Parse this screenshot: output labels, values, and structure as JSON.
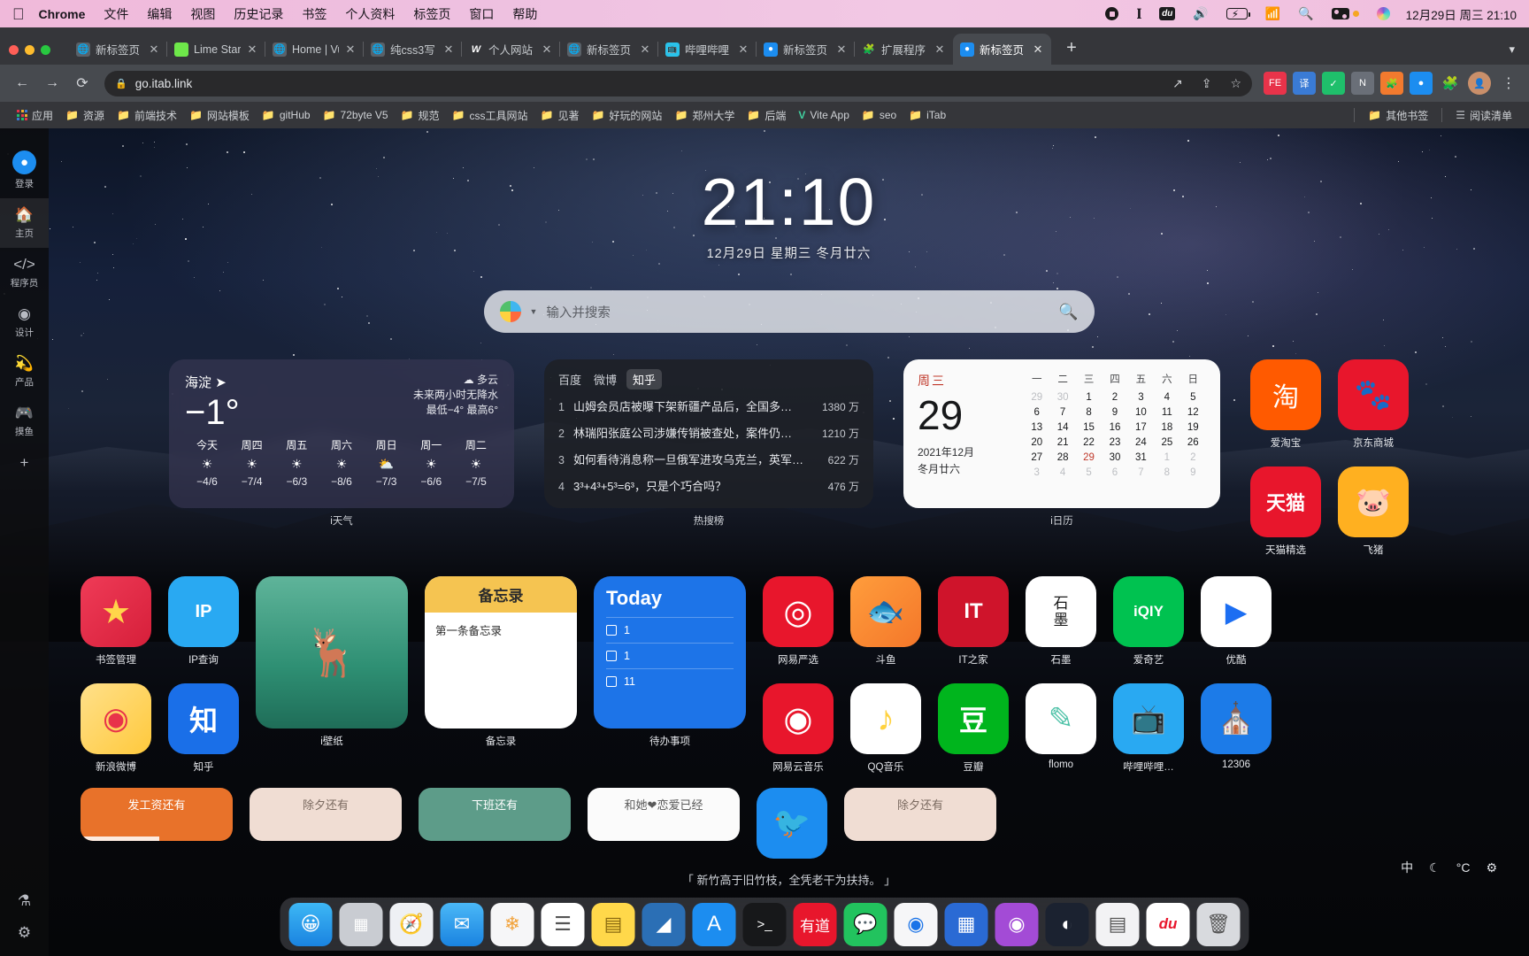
{
  "menubar": {
    "apple_icon": "apple-icon",
    "items": [
      "Chrome",
      "文件",
      "编辑",
      "视图",
      "历史记录",
      "书签",
      "个人资料",
      "标签页",
      "窗口",
      "帮助"
    ],
    "status_icons": [
      "record-icon",
      "p-icon",
      "du-icon",
      "volume-icon",
      "battery-charging-icon",
      "wifi-icon",
      "search-icon",
      "control-center-icon",
      "orange-dot-icon",
      "siri-icon"
    ],
    "clock": "12月29日 周三  21:10"
  },
  "browser": {
    "tabs": [
      {
        "title": "新标签页",
        "favicon": "globe-icon",
        "active": false
      },
      {
        "title": "Lime Star",
        "favicon": "lime-icon",
        "active": false
      },
      {
        "title": "Home | Vu",
        "favicon": "globe-icon",
        "active": false
      },
      {
        "title": "纯css3写",
        "favicon": "globe-icon",
        "active": false
      },
      {
        "title": "个人网站",
        "favicon": "vv-icon",
        "active": false
      },
      {
        "title": "新标签页",
        "favicon": "globe-icon",
        "active": false
      },
      {
        "title": "哔哩哔哩",
        "favicon": "bilibili-icon",
        "active": false
      },
      {
        "title": "新标签页",
        "favicon": "itab-icon",
        "active": false
      },
      {
        "title": "扩展程序",
        "favicon": "puzzle-icon",
        "active": false
      },
      {
        "title": "新标签页",
        "favicon": "itab-icon",
        "active": true
      }
    ],
    "close_label": "✕",
    "new_tab_label": "+",
    "tab_list_chevron": "chevron-down-icon",
    "nav": {
      "back": "←",
      "forward": "→",
      "reload": "⟳"
    },
    "omnibox": {
      "lock": "🔒",
      "url": "go.itab.link",
      "share": "share-icon",
      "install": "install-icon",
      "star": "star-icon"
    },
    "toolbar_icons": [
      "fe-extension-icon",
      "translate-extension-icon",
      "checkmark-extension-icon",
      "n-extension-icon",
      "puzzle-color-icon",
      "itab-extension-icon",
      "extensions-icon",
      "profile-avatar-icon",
      "more-menu-icon"
    ],
    "bookmarks": [
      {
        "icon": "apps-grid-icon",
        "label": "应用"
      },
      {
        "icon": "folder-icon",
        "label": "资源"
      },
      {
        "icon": "folder-icon",
        "label": "前端技术"
      },
      {
        "icon": "folder-icon",
        "label": "网站模板"
      },
      {
        "icon": "folder-icon",
        "label": "gitHub"
      },
      {
        "icon": "folder-icon",
        "label": "72byte V5"
      },
      {
        "icon": "folder-icon",
        "label": "规范"
      },
      {
        "icon": "folder-icon",
        "label": "css工具网站"
      },
      {
        "icon": "folder-icon",
        "label": "见著"
      },
      {
        "icon": "folder-icon",
        "label": "好玩的网站"
      },
      {
        "icon": "folder-icon",
        "label": "郑州大学"
      },
      {
        "icon": "folder-icon",
        "label": "后端"
      },
      {
        "icon": "vite-icon",
        "label": "Vite App"
      },
      {
        "icon": "folder-icon",
        "label": "seo"
      },
      {
        "icon": "folder-icon",
        "label": "iTab"
      }
    ],
    "bookmarks_right": [
      {
        "icon": "folder-icon",
        "label": "其他书签"
      },
      {
        "icon": "reading-list-icon",
        "label": "阅读清单"
      }
    ]
  },
  "rail": {
    "login": {
      "icon": "itab-avatar-icon",
      "label": "登录"
    },
    "items": [
      {
        "icon": "home-icon",
        "label": "主页",
        "selected": true
      },
      {
        "icon": "code-icon",
        "label": "程序员",
        "selected": false
      },
      {
        "icon": "design-icon",
        "label": "设计",
        "selected": false
      },
      {
        "icon": "product-icon",
        "label": "产品",
        "selected": false
      },
      {
        "icon": "game-icon",
        "label": "摸鱼",
        "selected": false
      }
    ],
    "add_label": "+",
    "bottom": [
      {
        "icon": "lab-icon",
        "label": "实验室"
      },
      {
        "icon": "gear-icon",
        "label": "设置"
      }
    ]
  },
  "home": {
    "clock": "21:10",
    "date": "12月29日 星期三 冬月廿六",
    "search": {
      "engine": "search-engine-icon",
      "placeholder": "输入并搜索",
      "submit": "search-icon"
    }
  },
  "weather": {
    "widget_label": "i天气",
    "city": "海淀",
    "location_icon": "location-arrow-icon",
    "temp": "−1°",
    "condition_icon": "cloudy-icon",
    "condition": "多云",
    "forecast_line": "未来两小时无降水",
    "range_line": "最低−4° 最高6°",
    "days": [
      {
        "name": "今天",
        "icon": "sun-icon",
        "range": "−4/6"
      },
      {
        "name": "周四",
        "icon": "sun-icon",
        "range": "−7/4"
      },
      {
        "name": "周五",
        "icon": "sun-icon",
        "range": "−6/3"
      },
      {
        "name": "周六",
        "icon": "sun-icon",
        "range": "−8/6"
      },
      {
        "name": "周日",
        "icon": "partly-cloudy-icon",
        "range": "−7/3"
      },
      {
        "name": "周一",
        "icon": "sun-icon",
        "range": "−6/6"
      },
      {
        "name": "周二",
        "icon": "sun-icon",
        "range": "−7/5"
      }
    ]
  },
  "hotlist": {
    "widget_label": "热搜榜",
    "tabs": [
      {
        "label": "百度",
        "selected": false
      },
      {
        "label": "微博",
        "selected": false
      },
      {
        "label": "知乎",
        "selected": true
      }
    ],
    "rows": [
      {
        "rank": "1",
        "title": "山姆会员店被曝下架新疆产品后，全国多…",
        "value": "1380 万"
      },
      {
        "rank": "2",
        "title": "林瑞阳张庭公司涉嫌传销被查处，案件仍…",
        "value": "1210 万"
      },
      {
        "rank": "3",
        "title": "如何看待消息称一旦俄军进攻乌克兰，英军…",
        "value": "622 万"
      },
      {
        "rank": "4",
        "title": "3³+4³+5³=6³，只是个巧合吗？",
        "value": "476 万"
      }
    ]
  },
  "calendar": {
    "widget_label": "i日历",
    "weekday": "周三",
    "day": "29",
    "year_month": "2021年12月",
    "lunar": "冬月廿六",
    "headers": [
      "一",
      "二",
      "三",
      "四",
      "五",
      "六",
      "日"
    ],
    "weeks": [
      [
        {
          "d": "29",
          "t": "mut"
        },
        {
          "d": "30",
          "t": "mut"
        },
        {
          "d": "1",
          "t": ""
        },
        {
          "d": "2",
          "t": ""
        },
        {
          "d": "3",
          "t": ""
        },
        {
          "d": "4",
          "t": ""
        },
        {
          "d": "5",
          "t": ""
        }
      ],
      [
        {
          "d": "6",
          "t": ""
        },
        {
          "d": "7",
          "t": ""
        },
        {
          "d": "8",
          "t": ""
        },
        {
          "d": "9",
          "t": ""
        },
        {
          "d": "10",
          "t": ""
        },
        {
          "d": "11",
          "t": ""
        },
        {
          "d": "12",
          "t": ""
        }
      ],
      [
        {
          "d": "13",
          "t": ""
        },
        {
          "d": "14",
          "t": ""
        },
        {
          "d": "15",
          "t": ""
        },
        {
          "d": "16",
          "t": ""
        },
        {
          "d": "17",
          "t": ""
        },
        {
          "d": "18",
          "t": ""
        },
        {
          "d": "19",
          "t": ""
        }
      ],
      [
        {
          "d": "20",
          "t": ""
        },
        {
          "d": "21",
          "t": ""
        },
        {
          "d": "22",
          "t": ""
        },
        {
          "d": "23",
          "t": ""
        },
        {
          "d": "24",
          "t": ""
        },
        {
          "d": "25",
          "t": ""
        },
        {
          "d": "26",
          "t": ""
        }
      ],
      [
        {
          "d": "27",
          "t": ""
        },
        {
          "d": "28",
          "t": ""
        },
        {
          "d": "29",
          "t": "today"
        },
        {
          "d": "30",
          "t": ""
        },
        {
          "d": "31",
          "t": ""
        },
        {
          "d": "1",
          "t": "mut"
        },
        {
          "d": "2",
          "t": "mut"
        }
      ],
      [
        {
          "d": "3",
          "t": "mut"
        },
        {
          "d": "4",
          "t": "mut"
        },
        {
          "d": "5",
          "t": "mut"
        },
        {
          "d": "6",
          "t": "mut"
        },
        {
          "d": "7",
          "t": "mut"
        },
        {
          "d": "8",
          "t": "mut"
        },
        {
          "d": "9",
          "t": "mut"
        }
      ]
    ]
  },
  "apps_row1": [
    {
      "name": "书签管理",
      "icon": "star-icon",
      "bg": "#e8334a",
      "fg": "#ffd54a",
      "glyph": "★"
    },
    {
      "name": "IP查询",
      "icon": "ip-pin-icon",
      "bg": "#29a9f2",
      "fg": "#ffffff",
      "glyph": "IP"
    },
    {
      "name": "网易严选",
      "icon": "yanxuan-icon",
      "bg": "#e8162c",
      "fg": "#ffffff",
      "glyph": "⊕"
    },
    {
      "name": "斗鱼",
      "icon": "douyu-icon",
      "bg": "#f4772a",
      "fg": "#ffffff",
      "glyph": "🐟"
    },
    {
      "name": "IT之家",
      "icon": "ithome-icon",
      "bg": "#cf142b",
      "fg": "#ffffff",
      "glyph": "IT"
    },
    {
      "name": "石墨",
      "icon": "shimo-icon",
      "bg": "#ffffff",
      "fg": "#1a1a1a",
      "glyph": "石墨"
    },
    {
      "name": "爱奇艺",
      "icon": "iqiyi-icon",
      "bg": "#00c250",
      "fg": "#ffffff",
      "glyph": "iQIY"
    },
    {
      "name": "优酷",
      "icon": "youku-icon",
      "bg": "#ffffff",
      "fg": "#1c6ef2",
      "glyph": "▶"
    }
  ],
  "apps_row2": [
    {
      "name": "新浪微博",
      "icon": "weibo-icon",
      "bg": "#ffd24a",
      "fg": "#e8334a",
      "glyph": "◉"
    },
    {
      "name": "知乎",
      "icon": "zhihu-icon",
      "bg": "#1a6fe8",
      "fg": "#ffffff",
      "glyph": "知"
    },
    {
      "name": "网易云音乐",
      "icon": "netease-music-icon",
      "bg": "#e8162c",
      "fg": "#ffffff",
      "glyph": "◎"
    },
    {
      "name": "QQ音乐",
      "icon": "qq-music-icon",
      "bg": "#ffffff",
      "fg": "#ffd23f",
      "glyph": "♪"
    },
    {
      "name": "豆瓣",
      "icon": "douban-icon",
      "bg": "#00b51d",
      "fg": "#ffffff",
      "glyph": "豆"
    },
    {
      "name": "flomo",
      "icon": "flomo-icon",
      "bg": "#ffffff",
      "fg": "#4fc2a8",
      "glyph": "✏"
    },
    {
      "name": "哔哩哔哩…",
      "icon": "bilibili-icon",
      "bg": "#29a9f2",
      "fg": "#ffffff",
      "glyph": "📺"
    },
    {
      "name": "12306",
      "icon": "railway-icon",
      "bg": "#1c7be8",
      "fg": "#ffffff",
      "glyph": "⊚"
    }
  ],
  "right_apps": [
    {
      "name": "爱淘宝",
      "icon": "taobao-icon",
      "bg": "#ff5a00",
      "fg": "#ffffff",
      "glyph": "淘"
    },
    {
      "name": "京东商城",
      "icon": "jd-icon",
      "bg": "#e8162c",
      "fg": "#ffffff",
      "glyph": "🐶"
    },
    {
      "name": "天猫精选",
      "icon": "tmall-icon",
      "bg": "#e8162c",
      "fg": "#ffffff",
      "glyph": "天猫"
    },
    {
      "name": "飞猪",
      "icon": "fliggy-icon",
      "bg": "#ffb020",
      "fg": "#ffffff",
      "glyph": "🐷"
    }
  ],
  "widgets_mid": {
    "wallpaper": {
      "label": "i壁纸",
      "icon": "wallpaper-icon"
    },
    "memo": {
      "label": "备忘录",
      "title": "备忘录",
      "first_line": "第一条备忘录"
    },
    "todo": {
      "label": "待办事项",
      "title": "Today",
      "items": [
        "1",
        "1",
        "11"
      ]
    }
  },
  "countdowns": [
    {
      "label": "发工资还有",
      "bg": "#e8722a",
      "fg": "#ffffff",
      "progress": 52
    },
    {
      "label": "除夕还有",
      "bg": "#f0ddd3",
      "fg": "#7a6a60",
      "progress": 0
    },
    {
      "label": "下班还有",
      "bg": "#5d9c89",
      "fg": "#ffffff",
      "progress": 0
    },
    {
      "label": "和她❤恋爱已经",
      "bg": "#fbfbfb",
      "fg": "#5a5a5a",
      "progress": 0
    },
    {
      "label": "",
      "bg": "transparent",
      "fg": "#ffffff",
      "progress": 0
    },
    {
      "label": "除夕还有",
      "bg": "#f0ddd3",
      "fg": "#7a6a60",
      "progress": 0
    }
  ],
  "quote": "「 新竹高于旧竹枝，全凭老干为扶持。 」",
  "tray": [
    {
      "icon": "language-icon",
      "label": "中"
    },
    {
      "icon": "moon-icon",
      "label": "☾"
    },
    {
      "icon": "temperature-icon",
      "label": "°C"
    },
    {
      "icon": "gear-icon",
      "label": "⚙"
    }
  ],
  "dock": [
    {
      "name": "finder-icon",
      "bg": "#2a9bf0",
      "glyph": "🙂"
    },
    {
      "name": "launchpad-icon",
      "bg": "#c9ccd2",
      "glyph": "⬚"
    },
    {
      "name": "safari-icon",
      "bg": "#e9eaee",
      "glyph": "🧭"
    },
    {
      "name": "mail-icon",
      "bg": "#2a9bf0",
      "glyph": "✉"
    },
    {
      "name": "photos-icon",
      "bg": "#f2f2f4",
      "glyph": "❀"
    },
    {
      "name": "reminders-icon",
      "bg": "#ffffff",
      "glyph": "☰"
    },
    {
      "name": "notes-icon",
      "bg": "#ffd84a",
      "glyph": "▤"
    },
    {
      "name": "vscode-icon",
      "bg": "#2b6fb5",
      "glyph": "◢"
    },
    {
      "name": "appstore-icon",
      "bg": "#1c8df0",
      "glyph": "A"
    },
    {
      "name": "terminal-icon",
      "bg": "#17181a",
      "glyph": ">_"
    },
    {
      "name": "youdao-icon",
      "bg": "#e8162c",
      "glyph": "有道"
    },
    {
      "name": "wechat-icon",
      "bg": "#22c35e",
      "glyph": "💬"
    },
    {
      "name": "chrome-icon",
      "bg": "#f2f2f4",
      "glyph": "◉"
    },
    {
      "name": "teams-icon",
      "bg": "#2a6ad4",
      "glyph": "▦"
    },
    {
      "name": "podcast-icon",
      "bg": "#a34bd6",
      "glyph": "◉"
    },
    {
      "name": "qq-browser-icon",
      "bg": "#1b2230",
      "glyph": "◐"
    },
    {
      "name": "calculator-icon",
      "bg": "#f2f2f4",
      "glyph": "▤"
    },
    {
      "name": "baidu-netdisk-icon",
      "bg": "#ffffff",
      "glyph": "du"
    },
    {
      "name": "trash-icon",
      "bg": "#d8dade",
      "glyph": "🗑"
    }
  ]
}
